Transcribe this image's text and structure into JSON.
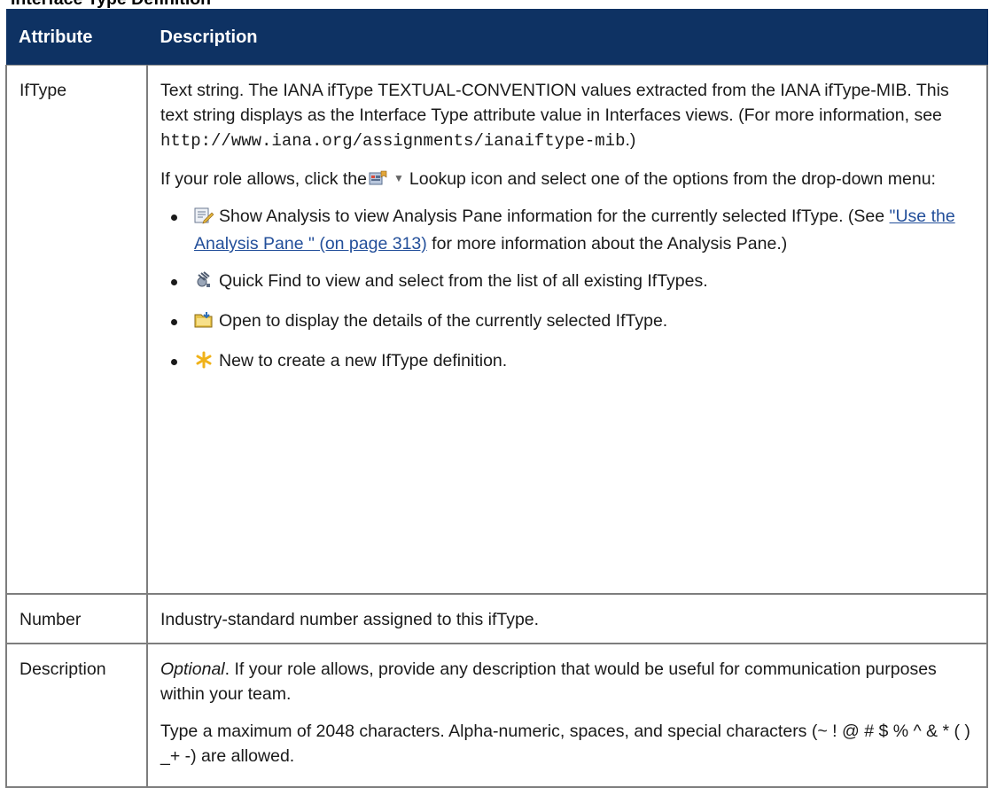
{
  "doc_title": "Interface Type Definition",
  "table": {
    "headers": [
      "Attribute",
      "Description"
    ],
    "ifType": {
      "attr": "IfType",
      "para1_text": "Text string. The IANA ifType TEXTUAL-CONVENTION values extracted from the IANA ifType-MIB. This text string displays as the Interface Type attribute value in Interfaces views. (For more information, see ",
      "para1_url": "http://www.iana.org/assignments/ianaiftype-mib",
      "para1_end": ".)",
      "para2_pre": "If your role allows, click the",
      "para2_post": "Lookup icon and select one of the options from the drop-down menu:",
      "options": [
        {
          "icon": "show-analysis-icon",
          "pre": "Show Analysis to view Analysis Pane information for the currently selected IfType. (See ",
          "link": "\"Use the Analysis Pane \" (on page 313)",
          "post": " for more information about the Analysis Pane.)"
        },
        {
          "icon": "quick-find-icon",
          "text": "Quick Find to view and select from the list of all existing IfTypes."
        },
        {
          "icon": "open-icon",
          "text": "Open to display the details of the currently selected IfType."
        },
        {
          "icon": "new-icon",
          "text": "New to create a new IfType definition."
        }
      ]
    },
    "number": {
      "attr": "Number",
      "desc": "Industry-standard number assigned to this ifType."
    },
    "description": {
      "attr": "Description",
      "para1_em": "Optional",
      "para1_rest": ". If your role allows, provide any description that would be useful for communication purposes within your team.",
      "para2": "Type a maximum of 2048 characters. Alpha-numeric, spaces, and special characters (~ ! @ # $ % ^ & * ( ) _+ -) are allowed."
    }
  },
  "colors": {
    "header_bg": "#0e3263",
    "link": "#234f9a",
    "border": "#7d7d7d"
  }
}
